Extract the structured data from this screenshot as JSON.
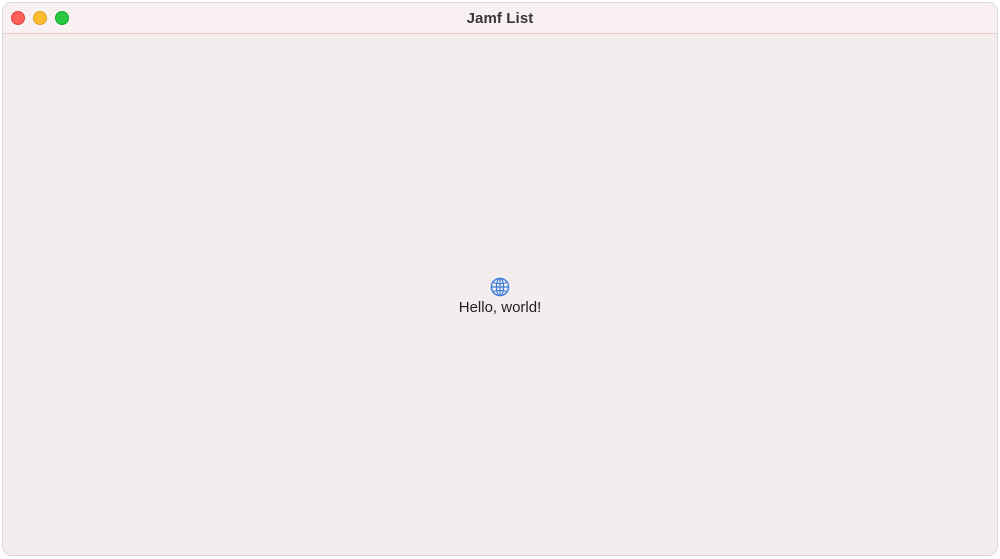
{
  "window": {
    "title": "Jamf List"
  },
  "content": {
    "icon": "globe-icon",
    "greeting": "Hello, world!"
  },
  "colors": {
    "accent": "#3b7dd8",
    "close": "#fe5f57",
    "minimize": "#febc2e",
    "zoom": "#28c840"
  }
}
